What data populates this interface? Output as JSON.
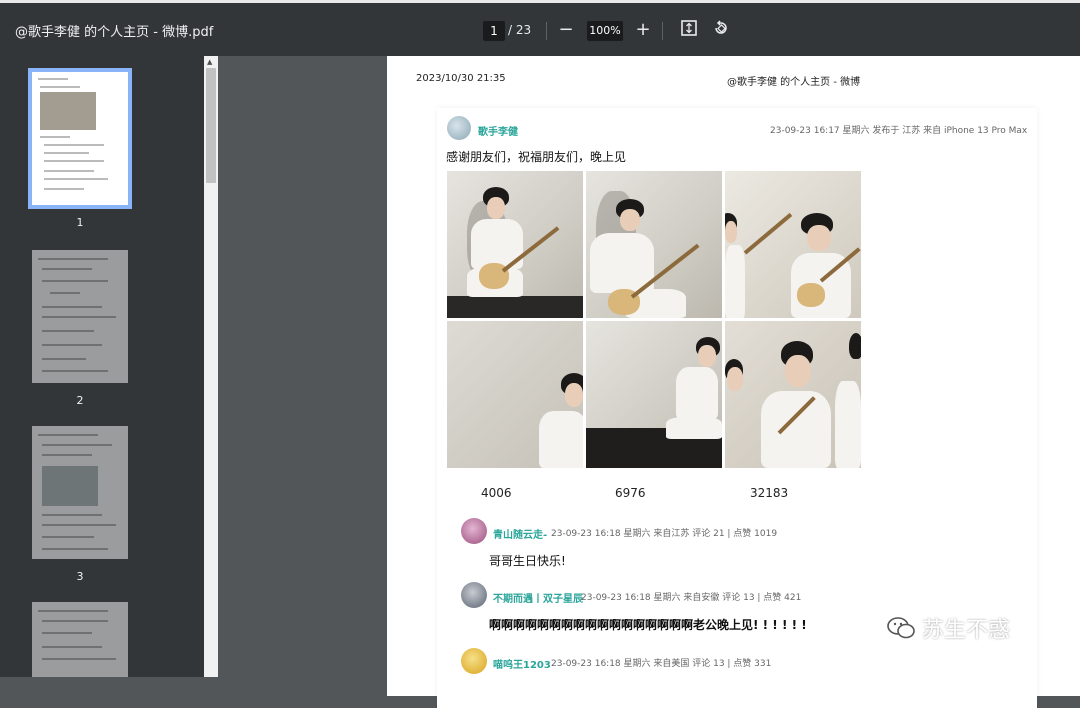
{
  "toolbar": {
    "title": "@歌手李健 的个人主页 - 微博.pdf",
    "page_current": "1",
    "page_total": "/ 23",
    "zoom": "100%",
    "zoom_out_icon": "minus-icon",
    "zoom_in_icon": "plus-icon",
    "fit_icon": "fit-page-icon",
    "rotate_icon": "rotate-icon"
  },
  "sidebar": {
    "thumbnails": [
      {
        "label": "1"
      },
      {
        "label": "2"
      },
      {
        "label": "3"
      }
    ]
  },
  "page": {
    "header_date": "2023/10/30 21:35",
    "header_title": "@歌手李健 的个人主页 - 微博",
    "post": {
      "author": "歌手李健",
      "meta": "23-09-23 16:17 星期六    发布于 江苏    来自 iPhone 13 Pro Max",
      "text": "感谢朋友们，祝福朋友们，晚上见",
      "counts": [
        "4006",
        "6976",
        "32183"
      ]
    },
    "comments": [
      {
        "name": "青山随云走-",
        "meta": "23-09-23 16:18 星期六    来自江苏    评论 21 | 点赞 1019",
        "text": "哥哥生日快乐!"
      },
      {
        "name": "不期而遇丨双子星辰",
        "meta": "23-09-23 16:18 星期六    来自安徽    评论 13 | 点赞 421",
        "text": "啊啊啊啊啊啊啊啊啊啊啊啊啊啊啊啊啊老公晚上见! ! ! ! ! !"
      },
      {
        "name": "喵呜王1203",
        "meta": "23-09-23 16:18 星期六    来自美国    评论 13 | 点赞 331",
        "text": ""
      }
    ]
  },
  "watermark": "苏生不惑",
  "colors": {
    "toolbar": "#323639",
    "viewer_bg": "#525659",
    "accent_name": "#2aa59a",
    "thumb_selected": "#8ab4f8"
  }
}
